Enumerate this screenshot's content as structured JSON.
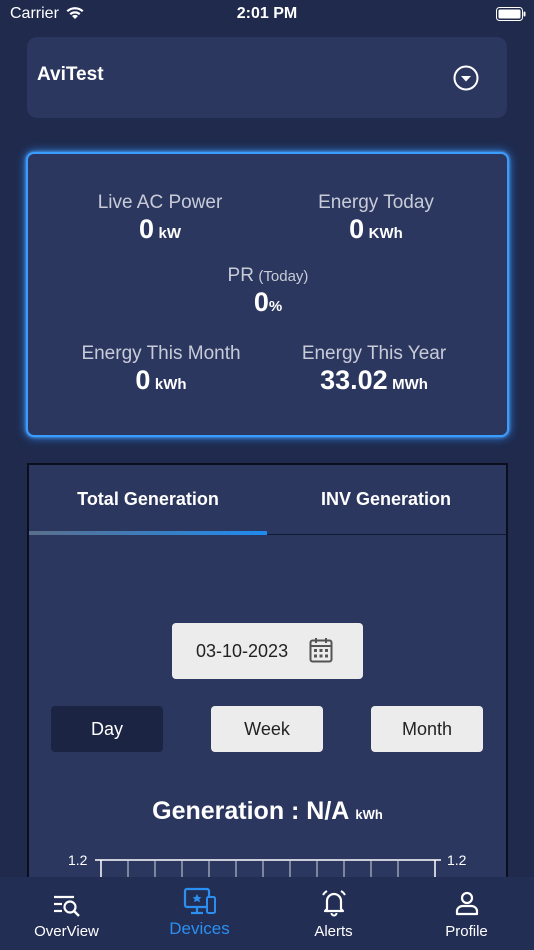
{
  "status_bar": {
    "carrier": "Carrier",
    "time": "2:01 PM"
  },
  "site": {
    "name": "AviTest"
  },
  "summary": {
    "live_ac_power": {
      "label": "Live AC Power",
      "value": "0",
      "unit": "kW"
    },
    "energy_today": {
      "label": "Energy Today",
      "value": "0",
      "unit": "KWh"
    },
    "pr": {
      "label": "PR",
      "sub": "(Today)",
      "value": "0",
      "unit": "%"
    },
    "energy_month": {
      "label": "Energy This Month",
      "value": "0",
      "unit": "kWh"
    },
    "energy_year": {
      "label": "Energy This Year",
      "value": "33.02",
      "unit": "MWh"
    }
  },
  "generation": {
    "tabs": [
      "Total Generation",
      "INV Generation"
    ],
    "active_tab": "Total Generation",
    "date": "03-10-2023",
    "ranges": [
      "Day",
      "Week",
      "Month"
    ],
    "active_range": "Day",
    "title": "Generation : N/A",
    "unit": "kWh",
    "axis": {
      "left_top": "1.2",
      "right_top": "1.2"
    }
  },
  "nav": {
    "items": [
      {
        "label": "OverView",
        "icon": "overview-search-icon"
      },
      {
        "label": "Devices",
        "icon": "devices-icon"
      },
      {
        "label": "Alerts",
        "icon": "bell-icon"
      },
      {
        "label": "Profile",
        "icon": "person-icon"
      }
    ],
    "active": "Devices"
  },
  "colors": {
    "background": "#1f2a4d",
    "card": "#2c3760",
    "accent": "#2a8ff0",
    "glow": "#3b9cff"
  }
}
